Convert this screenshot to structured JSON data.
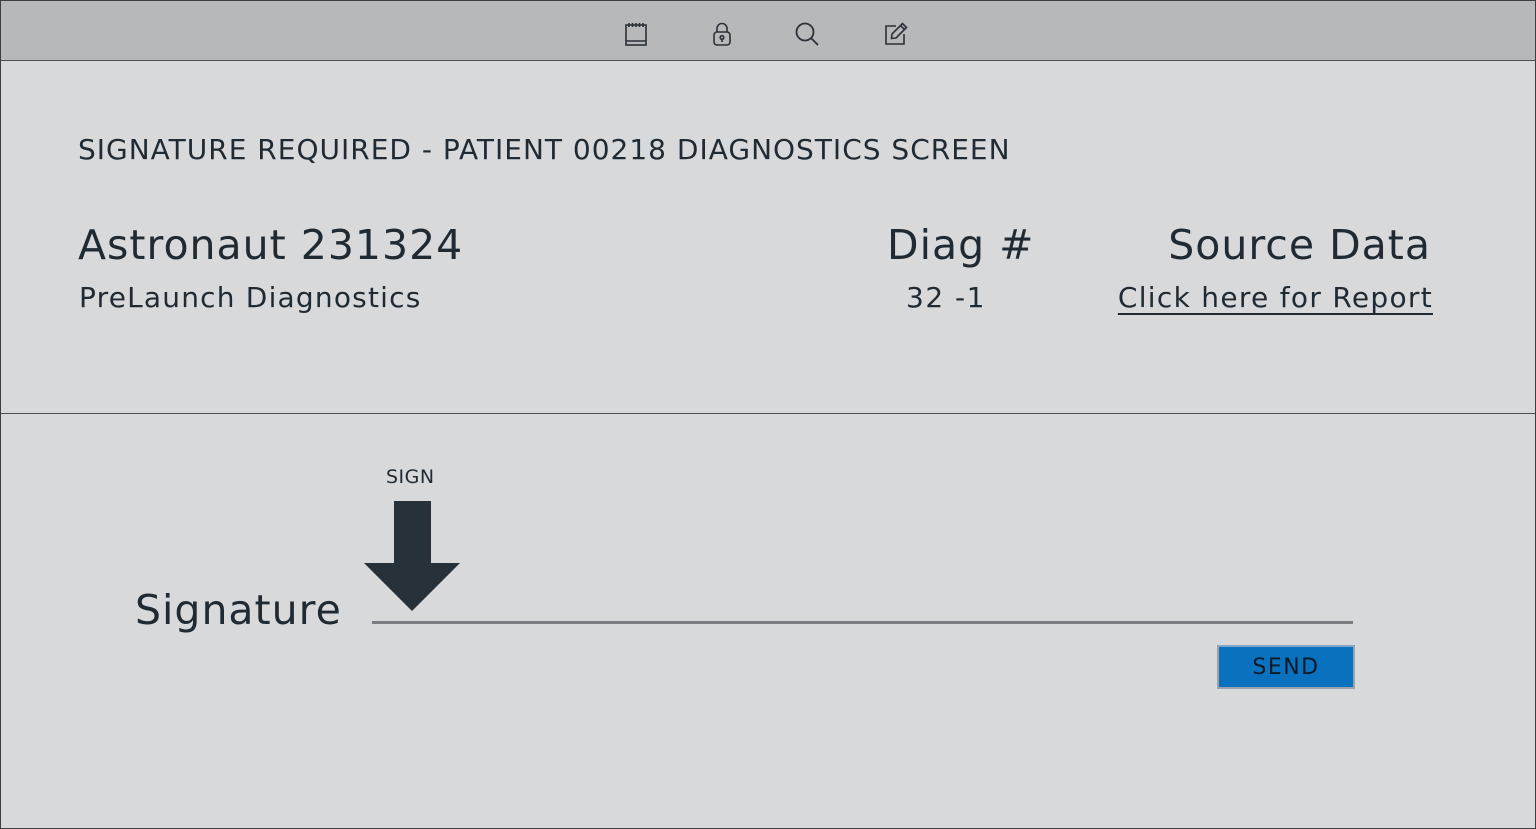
{
  "toolbar": {
    "icons": [
      "notepad-icon",
      "lock-icon",
      "search-icon",
      "edit-icon"
    ]
  },
  "header": {
    "title": "SIGNATURE REQUIRED - PATIENT 00218 DIAGNOSTICS SCREEN",
    "astronaut_name": "Astronaut 231324",
    "astronaut_subtitle": "PreLaunch Diagnostics",
    "diag_label": "Diag #",
    "diag_value": "32 -1",
    "source_label": "Source Data",
    "source_link": "Click here for Report"
  },
  "signature": {
    "hint": "SIGN",
    "label": "Signature",
    "value": "",
    "send_label": "SEND"
  },
  "colors": {
    "background": "#d8d9db",
    "toolbar": "#b7b8b9",
    "text": "#1f2a33",
    "send_button": "#0a71be",
    "arrow": "#27313a"
  }
}
